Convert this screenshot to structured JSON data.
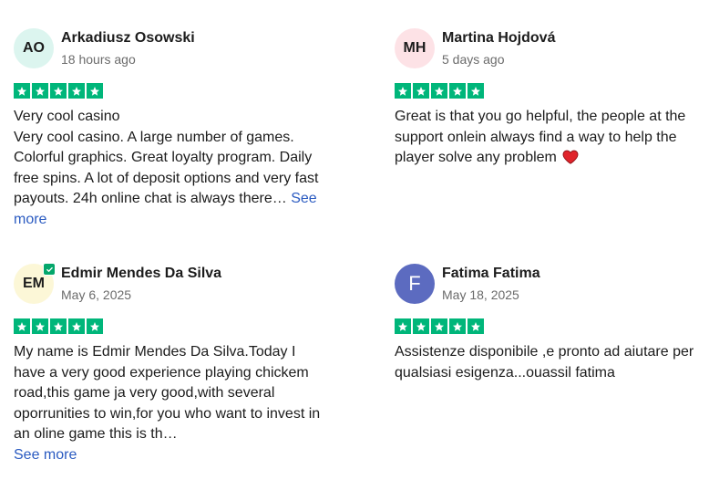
{
  "colors": {
    "star_green": "#00b67a",
    "link_blue": "#2b5bc1",
    "verified_green": "#04a76b"
  },
  "reviews": [
    {
      "initials": "AO",
      "avatar_color": "#dcf5ef",
      "name": "Arkadiusz Osowski",
      "date": "18 hours ago",
      "rating": 5,
      "title": "Very cool casino",
      "text": "Very cool casino. A large number of games. Colorful graphics. Great loyalty program. Daily free spins. A lot of deposit options and very fast payouts. 24h online chat is always there…",
      "see_more": "See more"
    },
    {
      "initials": "MH",
      "avatar_color": "#fde2e6",
      "name": "Martina Hojdová",
      "date": "5 days ago",
      "rating": 5,
      "text": "Great is that you go helpful, the people at the support onlein always find a way to help the player solve any problem",
      "emoji": "heart-icon"
    },
    {
      "initials": "EM",
      "avatar_color": "#fcf7d7",
      "verified": true,
      "name": "Edmir Mendes Da Silva",
      "date": "May 6, 2025",
      "rating": 5,
      "text": "My name is Edmir Mendes Da Silva.Today I have a very good experience playing chickem road,this game ja very good,with several oporrunities to win,for you who want to invest in an oline game this is th…",
      "see_more": "See more"
    },
    {
      "initials": "F",
      "avatar_color": "#5c6bc0",
      "name": "Fatima Fatima",
      "date": "May 18, 2025",
      "rating": 5,
      "text": "Assistenze disponibile ,e pronto ad aiutare per qualsiasi esigenza...ouassil fatima"
    }
  ]
}
